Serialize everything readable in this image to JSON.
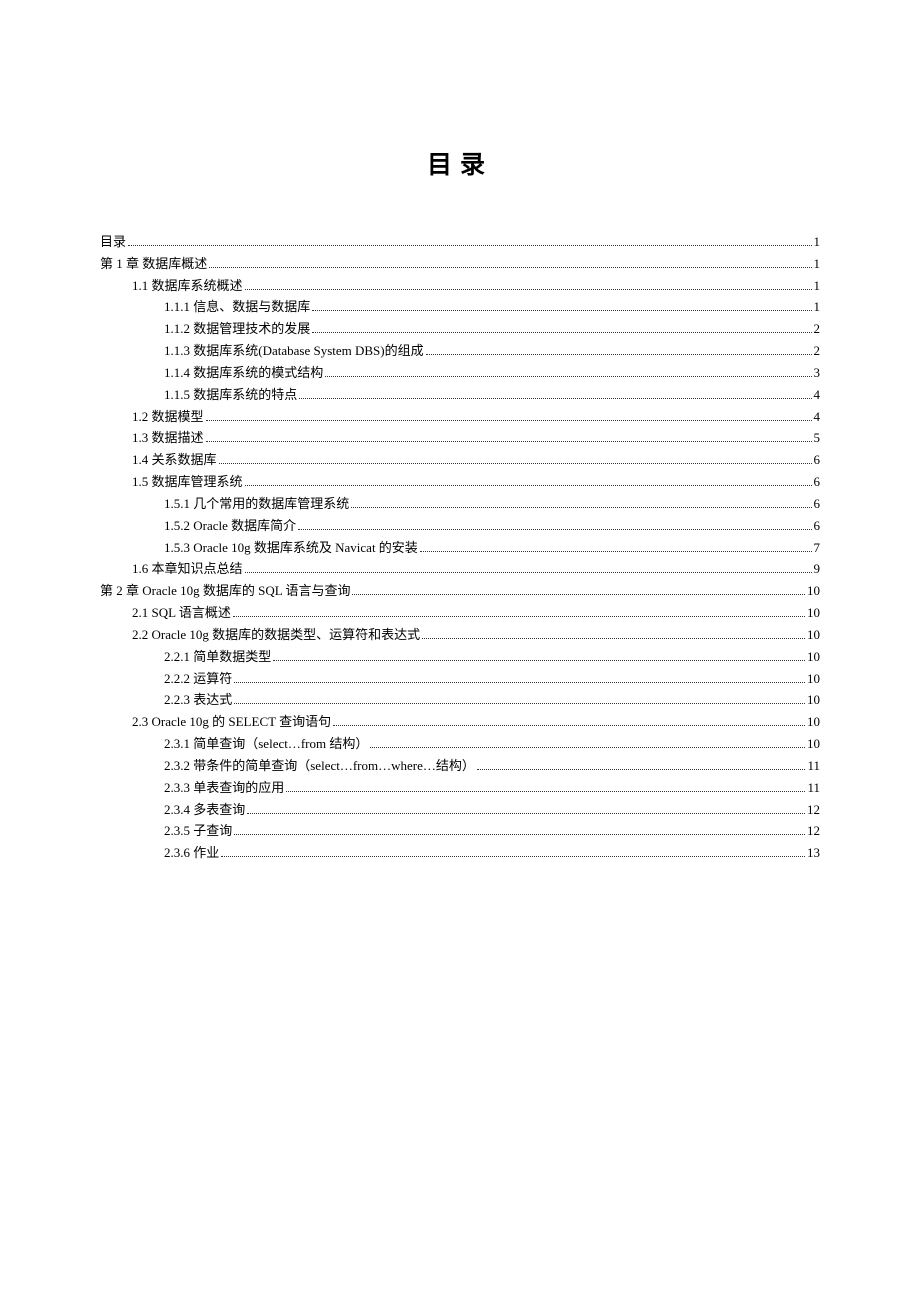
{
  "title": "目录",
  "entries": [
    {
      "level": 0,
      "label": "目录",
      "page": "1"
    },
    {
      "level": 0,
      "label": "第 1 章 数据库概述",
      "page": "1"
    },
    {
      "level": 1,
      "label": "1.1 数据库系统概述",
      "page": "1"
    },
    {
      "level": 2,
      "label": "1.1.1 信息、数据与数据库",
      "page": "1"
    },
    {
      "level": 2,
      "label": "1.1.2 数据管理技术的发展",
      "page": "2"
    },
    {
      "level": 2,
      "label": "1.1.3 数据库系统(Database System DBS)的组成",
      "page": "2"
    },
    {
      "level": 2,
      "label": "1.1.4 数据库系统的模式结构",
      "page": "3"
    },
    {
      "level": 2,
      "label": "1.1.5 数据库系统的特点",
      "page": "4"
    },
    {
      "level": 1,
      "label": "1.2 数据模型",
      "page": "4"
    },
    {
      "level": 1,
      "label": "1.3 数据描述",
      "page": "5"
    },
    {
      "level": 1,
      "label": "1.4 关系数据库",
      "page": "6"
    },
    {
      "level": 1,
      "label": "1.5 数据库管理系统",
      "page": "6"
    },
    {
      "level": 2,
      "label": "1.5.1 几个常用的数据库管理系统",
      "page": "6"
    },
    {
      "level": 2,
      "label": "1.5.2 Oracle 数据库简介",
      "page": "6"
    },
    {
      "level": 2,
      "label": "1.5.3 Oracle 10g 数据库系统及 Navicat 的安装",
      "page": "7"
    },
    {
      "level": 1,
      "label": "1.6 本章知识点总结",
      "page": "9"
    },
    {
      "level": 0,
      "label": "第 2 章 Oracle 10g 数据库的 SQL 语言与查询",
      "page": "10"
    },
    {
      "level": 1,
      "label": "2.1 SQL 语言概述",
      "page": "10"
    },
    {
      "level": 1,
      "label": "2.2 Oracle 10g 数据库的数据类型、运算符和表达式",
      "page": "10"
    },
    {
      "level": 2,
      "label": "2.2.1 简单数据类型",
      "page": "10"
    },
    {
      "level": 2,
      "label": "2.2.2 运算符",
      "page": "10"
    },
    {
      "level": 2,
      "label": "2.2.3 表达式",
      "page": "10"
    },
    {
      "level": 1,
      "label": "2.3 Oracle 10g 的 SELECT 查询语句",
      "page": "10"
    },
    {
      "level": 2,
      "label": "2.3.1 简单查询（select…from 结构）",
      "page": "10"
    },
    {
      "level": 2,
      "label": "2.3.2 带条件的简单查询（select…from…where…结构）",
      "page": "11"
    },
    {
      "level": 2,
      "label": "2.3.3 单表查询的应用",
      "page": "11"
    },
    {
      "level": 2,
      "label": "2.3.4 多表查询",
      "page": "12"
    },
    {
      "level": 2,
      "label": "2.3.5 子查询",
      "page": "12"
    },
    {
      "level": 2,
      "label": "2.3.6 作业",
      "page": "13"
    }
  ]
}
